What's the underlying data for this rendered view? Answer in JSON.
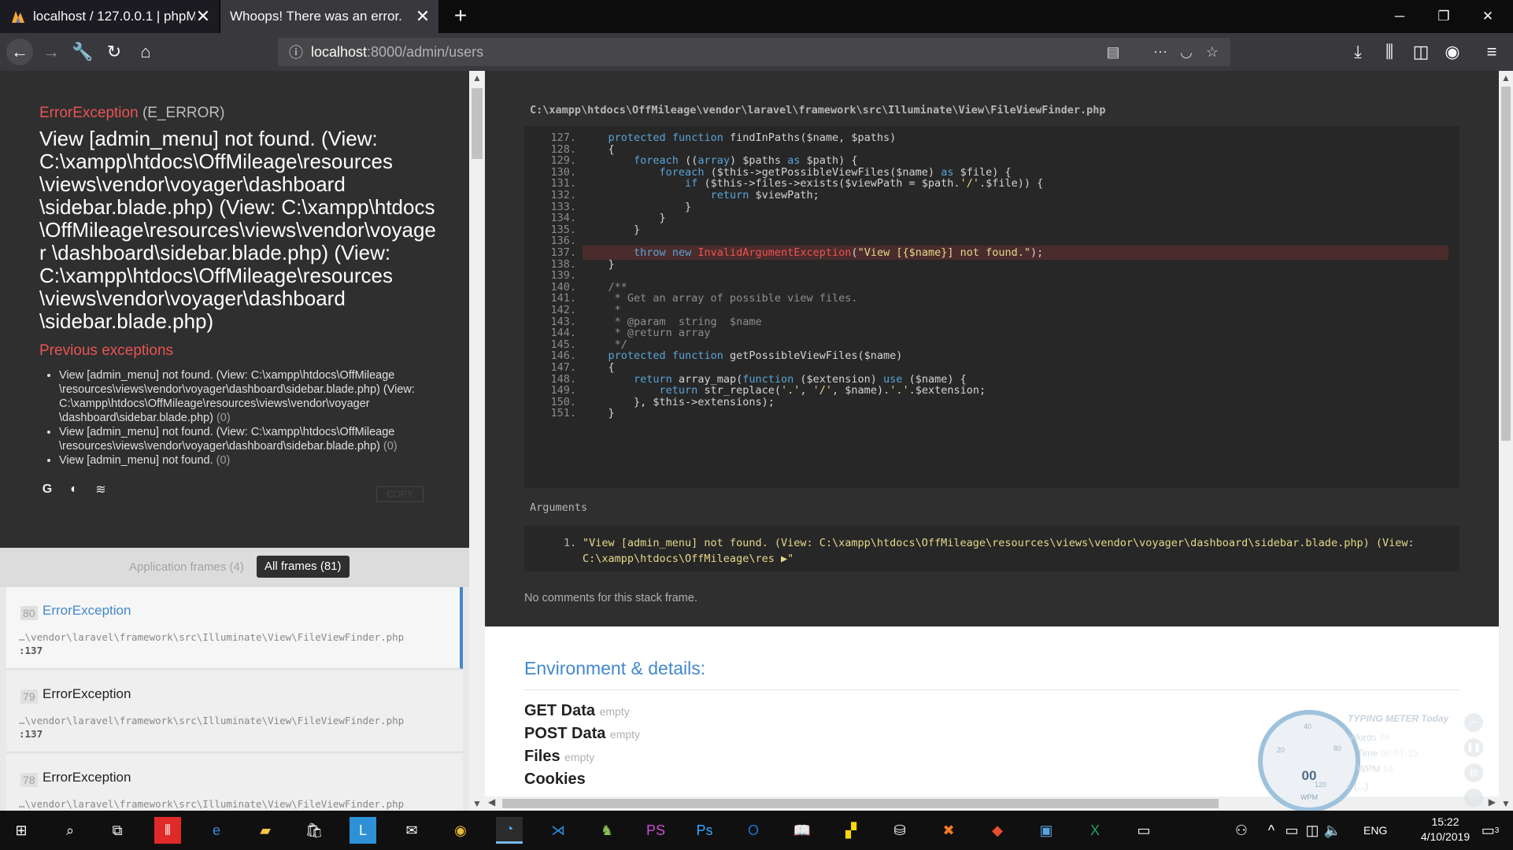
{
  "browser": {
    "tabs": [
      {
        "title": "localhost / 127.0.0.1 | phpMyAd",
        "active": false
      },
      {
        "title": "Whoops! There was an error.",
        "active": true
      }
    ],
    "url_host": "localhost",
    "url_rest": ":8000/admin/users"
  },
  "error": {
    "class": "ErrorException",
    "type": "(E_ERROR)",
    "message": "View [admin_menu] not found. (View: C:\\xampp\\htdocs\\OffMileage\\resources \\views\\vendor\\voyager\\dashboard \\sidebar.blade.php) (View: C:\\xampp\\htdocs \\OffMileage\\resources\\views\\vendor\\voyager \\dashboard\\sidebar.blade.php) (View: C:\\xampp\\htdocs\\OffMileage\\resources \\views\\vendor\\voyager\\dashboard \\sidebar.blade.php)",
    "previous_title": "Previous exceptions",
    "previous": [
      {
        "text": "View [admin_menu] not found. (View: C:\\xampp\\htdocs\\OffMileage \\resources\\views\\vendor\\voyager\\dashboard\\sidebar.blade.php) (View: C:\\xampp\\htdocs\\OffMileage\\resources\\views\\vendor\\voyager \\dashboard\\sidebar.blade.php)",
        "count": "(0)"
      },
      {
        "text": "View [admin_menu] not found. (View: C:\\xampp\\htdocs\\OffMileage \\resources\\views\\vendor\\voyager\\dashboard\\sidebar.blade.php)",
        "count": "(0)"
      },
      {
        "text": "View [admin_menu] not found.",
        "count": "(0)"
      }
    ],
    "copy_label": "COPY"
  },
  "frames_filter": {
    "app": "Application frames (4)",
    "all": "All frames (81)"
  },
  "frames": [
    {
      "num": "80",
      "name": "ErrorException",
      "path": "…\\vendor\\laravel\\framework\\src\\Illuminate\\View\\FileViewFinder.php",
      "line": ":137"
    },
    {
      "num": "79",
      "name": "ErrorException",
      "path": "…\\vendor\\laravel\\framework\\src\\Illuminate\\View\\FileViewFinder.php",
      "line": ":137"
    },
    {
      "num": "78",
      "name": "ErrorException",
      "path": "…\\vendor\\laravel\\framework\\src\\Illuminate\\View\\FileViewFinder.php",
      "line": ""
    }
  ],
  "code": {
    "file": "C:\\xampp\\htdocs\\OffMileage\\vendor\\laravel\\framework\\src\\Illuminate\\View\\FileViewFinder.php",
    "lines": [
      {
        "n": "127.",
        "t": "    protected function findInPaths($name, $paths)"
      },
      {
        "n": "128.",
        "t": "    {"
      },
      {
        "n": "129.",
        "t": "        foreach ((array) $paths as $path) {"
      },
      {
        "n": "130.",
        "t": "            foreach ($this->getPossibleViewFiles($name) as $file) {"
      },
      {
        "n": "131.",
        "t": "                if ($this->files->exists($viewPath = $path.'/'.$file)) {"
      },
      {
        "n": "132.",
        "t": "                    return $viewPath;"
      },
      {
        "n": "133.",
        "t": "                }"
      },
      {
        "n": "134.",
        "t": "            }"
      },
      {
        "n": "135.",
        "t": "        }"
      },
      {
        "n": "136.",
        "t": ""
      },
      {
        "n": "137.",
        "t": "        throw new InvalidArgumentException(\"View [{$name}] not found.\");"
      },
      {
        "n": "138.",
        "t": "    }"
      },
      {
        "n": "139.",
        "t": ""
      },
      {
        "n": "140.",
        "t": "    /**"
      },
      {
        "n": "141.",
        "t": "     * Get an array of possible view files."
      },
      {
        "n": "142.",
        "t": "     *"
      },
      {
        "n": "143.",
        "t": "     * @param  string  $name"
      },
      {
        "n": "144.",
        "t": "     * @return array"
      },
      {
        "n": "145.",
        "t": "     */"
      },
      {
        "n": "146.",
        "t": "    protected function getPossibleViewFiles($name)"
      },
      {
        "n": "147.",
        "t": "    {"
      },
      {
        "n": "148.",
        "t": "        return array_map(function ($extension) use ($name) {"
      },
      {
        "n": "149.",
        "t": "            return str_replace('.', '/', $name).'.'.$extension;"
      },
      {
        "n": "150.",
        "t": "        }, $this->extensions);"
      },
      {
        "n": "151.",
        "t": "    }"
      }
    ],
    "highlight": "137."
  },
  "arguments": {
    "title": "Arguments",
    "items": [
      {
        "n": "1.",
        "value": "\"View [admin_menu] not found. (View: C:\\xampp\\htdocs\\OffMileage\\resources\\views\\vendor\\voyager\\dashboard\\sidebar.blade.php) (View: C:\\xampp\\htdocs\\OffMileage\\res ▶\""
      }
    ]
  },
  "no_comments": "No comments for this stack frame.",
  "environment": {
    "title": "Environment & details:",
    "sections": [
      {
        "name": "GET Data",
        "state": "empty"
      },
      {
        "name": "POST Data",
        "state": "empty"
      },
      {
        "name": "Files",
        "state": "empty"
      },
      {
        "name": "Cookies",
        "state": ""
      }
    ]
  },
  "typing_meter": {
    "title": "TYPING METER Today",
    "words_label": "Words",
    "words": "79",
    "time_label": "Time",
    "time": "00:07:15",
    "wpm_label": "WPM",
    "wpm": "16",
    "gauge_value": "00",
    "gauge_label": "WPM",
    "ticks": [
      "20",
      "40",
      "80",
      "120"
    ],
    "search": "⌕ (...)"
  },
  "taskbar": {
    "lang": "ENG",
    "time": "15:22",
    "date": "4/10/2019",
    "notifications": "3"
  },
  "colors": {
    "accent": "#4288ce",
    "error": "#e95353"
  }
}
